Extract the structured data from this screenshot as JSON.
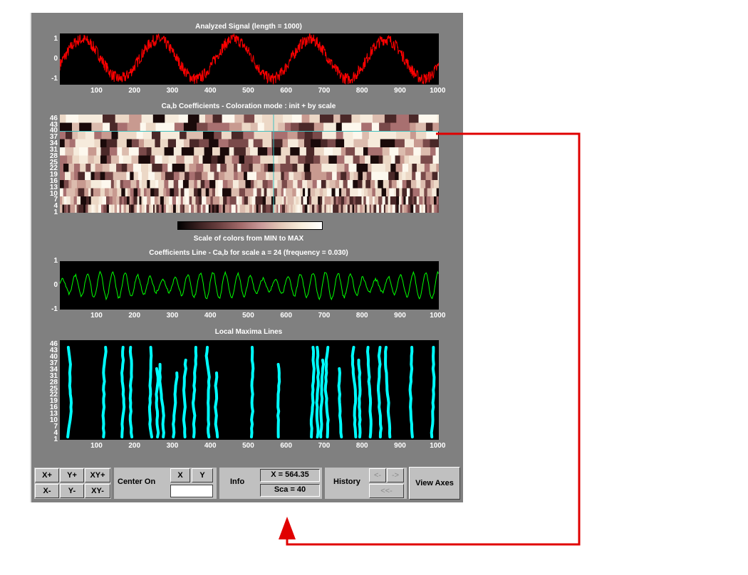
{
  "titles": {
    "signal": "Analyzed Signal  (length = 1000)",
    "coefs": "Ca,b Coefficients  - Coloration mode : init + by scale",
    "colorbar": "Scale of colors from MIN to MAX",
    "coefline": "Coefficients Line - Ca,b   for scale a = 24  (frequency =  0.030)",
    "maxima": "Local Maxima Lines"
  },
  "x_ticks": [
    "100",
    "200",
    "300",
    "400",
    "500",
    "600",
    "700",
    "800",
    "900",
    "1000"
  ],
  "signal_y_ticks": [
    "1",
    "0",
    "-1"
  ],
  "coefline_y_ticks": [
    "1",
    "0",
    "-1"
  ],
  "scale_ticks": [
    "46",
    "43",
    "40",
    "37",
    "34",
    "31",
    "28",
    "25",
    "22",
    "19",
    "16",
    "13",
    "10",
    "7",
    "4",
    "1"
  ],
  "colors": {
    "signal": "#ff0000",
    "coefline": "#00ff00",
    "maxima": "#00ffff",
    "crosshair": "#40c0c0",
    "arrow": "#e00000"
  },
  "toolbar": {
    "xplus": "X+",
    "yplus": "Y+",
    "xyplus": "XY+",
    "xminus": "X-",
    "yminus": "Y-",
    "xyminus": "XY-",
    "center_on": "Center On",
    "x": "X",
    "y": "Y",
    "center_value": "",
    "info": "Info",
    "x_readout": "X =  564.35",
    "sca_readout": "Sca = 40",
    "history": "History",
    "back": "<-",
    "forward": "->",
    "back_all": "<<-",
    "view_axes": "View Axes"
  },
  "chart_data": [
    {
      "type": "line",
      "title": "Analyzed Signal  (length = 1000)",
      "xlim": [
        1,
        1000
      ],
      "ylim": [
        -1.3,
        1.3
      ],
      "description_values": "sine period ~200 plus noise",
      "series": [
        {
          "period": 200,
          "amplitude": 1,
          "noise": 0.25
        }
      ]
    },
    {
      "type": "heatmap",
      "title": "Ca,b Coefficients  - Coloration mode : init + by scale",
      "xlim": [
        1,
        1000
      ],
      "ylim": [
        1,
        48
      ]
    },
    {
      "type": "line",
      "title": "Coefficients Line - Ca,b   for scale a = 24  (frequency =  0.030)",
      "xlim": [
        1,
        1000
      ],
      "ylim": [
        -1,
        1
      ]
    },
    {
      "type": "scatter",
      "title": "Local Maxima Lines",
      "xlim": [
        1,
        1000
      ],
      "ylim": [
        1,
        48
      ],
      "x_positions": [
        20,
        115,
        165,
        190,
        245,
        260,
        275,
        300,
        330,
        355,
        395,
        415,
        505,
        575,
        665,
        680,
        690,
        705,
        745,
        780,
        790,
        820,
        845,
        870,
        930,
        980
      ]
    }
  ]
}
